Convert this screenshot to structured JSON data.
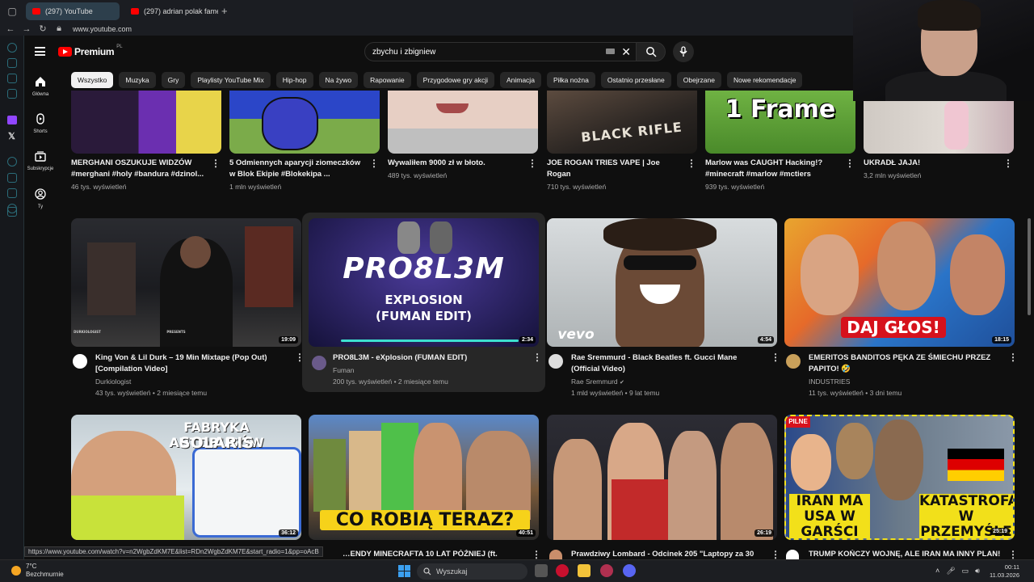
{
  "browser": {
    "tabs": [
      {
        "label": "(297) YouTube",
        "active": true
      },
      {
        "label": "(297) adrian polak fame m",
        "active": false
      }
    ],
    "url": "www.youtube.com"
  },
  "youtube": {
    "logo_text": "Premium",
    "country_code": "PL",
    "search_query": "zbychu i zbigniew",
    "chips": [
      "Wszystko",
      "Muzyka",
      "Gry",
      "Playlisty YouTube Mix",
      "Hip-hop",
      "Na żywo",
      "Rapowanie",
      "Przygodowe gry akcji",
      "Animacja",
      "Piłka nożna",
      "Ostatnio przesłane",
      "Obejrzane",
      "Nowe rekomendacje"
    ],
    "guide": [
      "Główna",
      "Shorts",
      "Subskrypcje",
      "Ty"
    ]
  },
  "row1": [
    {
      "title": "MERGHANI OSZUKUJE WIDZÓW #merghani #holy #bandura #dzinol...",
      "meta": "46 tys. wyświetleń"
    },
    {
      "title": "5 Odmiennych aparycji ziomeczków w Blok Ekipie #Blokekipa ...",
      "meta": "1 mln wyświetleń"
    },
    {
      "title": "Wywaliłem 9000 zł w błoto.",
      "meta": "489 tys. wyświetleń"
    },
    {
      "title": "JOE ROGAN TRIES VAPE | Joe Rogan",
      "meta": "710 tys. wyświetleń",
      "thumb_text": "BLACK RIFLE"
    },
    {
      "title": "Marlow was CAUGHT Hacking!? #minecraft #marlow #mctiers",
      "meta": "939 tys. wyświetleń",
      "thumb_text": "1 Frame"
    },
    {
      "title": "UKRADŁ JAJA!",
      "meta": "3,2 mln wyświetleń"
    }
  ],
  "row2": [
    {
      "title": "King Von & Lil Durk – 19 Min Mixtape (Pop Out) [Compilation Video]",
      "channel": "Durkiologist",
      "meta": "43 tys. wyświetleń • 2 miesiące temu",
      "duration": "19:09",
      "watermark": "DURKIOLOGIST",
      "watermark2": "PRESENTS"
    },
    {
      "title": "PRO8L3M - eXplosion (FUMAN EDIT)",
      "channel": "Fuman",
      "meta": "200 tys. wyświetleń • 2 miesiące temu",
      "duration": "2:34",
      "thumb_main": "PRO8L3M",
      "thumb_sub1": "EXPLOSION",
      "thumb_sub2": "(FUMAN EDIT)"
    },
    {
      "title": "Rae Sremmurd - Black Beatles ft. Gucci Mane (Official Video)",
      "channel": "Rae Sremmurd",
      "meta": "1 mld wyświetleń • 9 lat temu",
      "duration": "4:54",
      "thumb_text": "vevo"
    },
    {
      "title": "EMERITOS BANDITOS PĘKA ZE ŚMIECHU PRZEZ PAPITO! 🤣",
      "channel": "INDUSTRIES",
      "meta": "11 tys. wyświetleń • 3 dni temu",
      "duration": "18:15",
      "thumb_text": "DAJ GŁOS!"
    }
  ],
  "row3": [
    {
      "title": "…ENDY MINECRAFTA 10 LAT PÓŹNIEJ (ft.",
      "duration": "36:12",
      "thumb_text1": "FABRYKA AUTOBUSÓW",
      "thumb_text2": "SOLARIS"
    },
    {
      "title": "",
      "duration": "40:51",
      "thumb_text": "CO ROBIĄ TERAZ?"
    },
    {
      "title": "Prawdziwy Lombard - Odcinek 205 \"Laptopy za 30",
      "duration": "26:19"
    },
    {
      "title": "TRUMP KOŃCZY WOJNĘ, ALE IRAN MA INNY PLAN!",
      "duration": "25:19",
      "tag": "PILNE",
      "thumb_text1": "IRAN MA USA W GARŚCI",
      "thumb_text2": "KATASTROFA W PRZEMYŚLE"
    }
  ],
  "status_link": "https://www.youtube.com/watch?v=n2WgbZdKM7E&list=RDn2WgbZdKM7E&start_radio=1&pp=oAcB",
  "taskbar": {
    "temperature": "7°C",
    "weather": "Bezchmurnie",
    "search_label": "Wyszukaj",
    "time": "00:11",
    "date": "11.03.2026"
  }
}
